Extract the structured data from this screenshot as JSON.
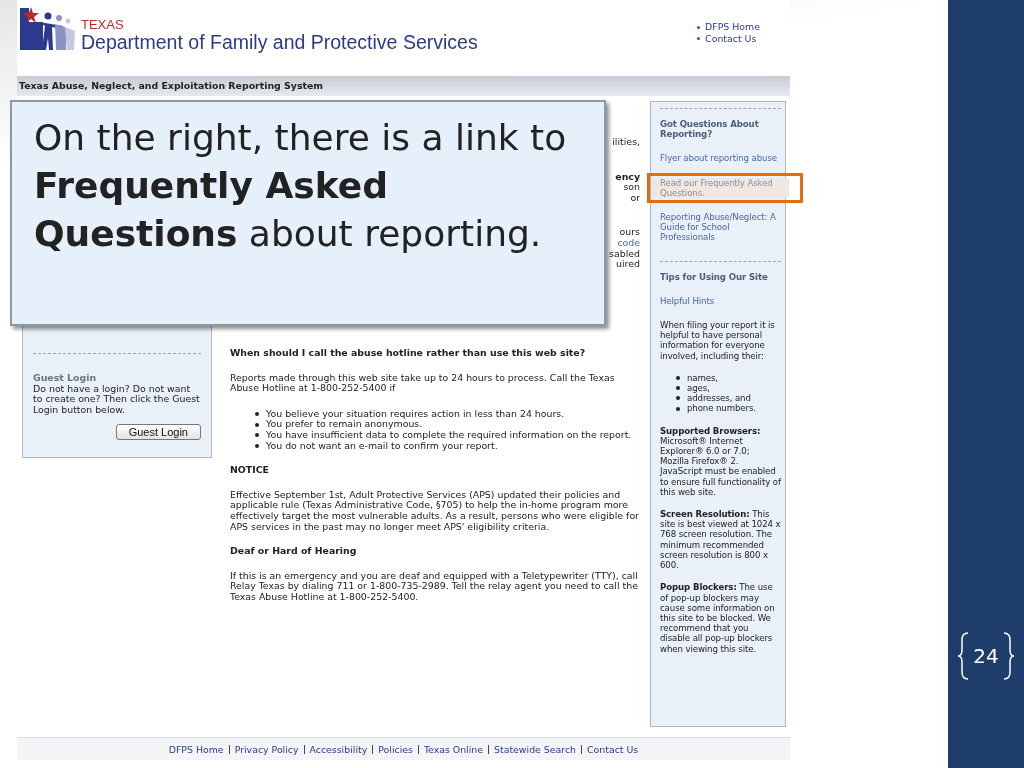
{
  "header": {
    "logo_small": "TEXAS",
    "logo_title": "Department of Family and Protective Services",
    "links": [
      "DFPS Home",
      "Contact Us"
    ]
  },
  "title_bar": "Texas Abuse, Neglect, and Exploitation Reporting System",
  "callout": "On the right, there is a link to **Frequently Asked Questions** about reporting.",
  "left_panel": {
    "heading": "Guest Login",
    "text": "Do not have a login? Do not want to create one? Then click the Guest Login button below.",
    "button": "Guest Login"
  },
  "covered_fragments": [
    [
      {
        "text": "ilities,",
        "kind": "plain"
      }
    ],
    [
      {
        "text": "ency",
        "kind": "bold"
      },
      {
        "text": "son",
        "kind": "plain"
      },
      {
        "text": "or",
        "kind": "plain"
      }
    ],
    [
      {
        "text": "ours",
        "kind": "plain"
      },
      {
        "text": "code",
        "kind": "link"
      },
      {
        "text": "sabled",
        "kind": "plain"
      },
      {
        "text": "uired",
        "kind": "plain"
      }
    ]
  ],
  "main": [
    {
      "kind": "heading",
      "text": "When should I call the abuse hotline rather than use this web site?"
    },
    {
      "kind": "paragraph",
      "text": "Reports made through this web site take up to 24 hours to process. Call the Texas Abuse Hotline at 1-800-252-5400 if"
    },
    {
      "kind": "list",
      "items": [
        "You believe your situation requires action in less than 24 hours.",
        "You prefer to remain anonymous.",
        "You have insufficient data to complete the required information on the report.",
        "You do not want an e-mail to confirm your report."
      ]
    },
    {
      "kind": "heading",
      "text": "NOTICE"
    },
    {
      "kind": "paragraph",
      "text": "Effective September 1st, Adult Protective Services (APS) updated their policies and applicable rule (Texas Administrative Code, §705) to help the in-home program more effectively target the most vulnerable adults. As a result, persons who were eligible for APS services in the past may no longer meet APS' eligibility criteria."
    },
    {
      "kind": "heading",
      "text": "Deaf or Hard of Hearing"
    },
    {
      "kind": "paragraph",
      "text": "If this is an emergency and you are deaf and equipped with a Teletypewriter (TTY), call Relay Texas by dialing 711 or 1-800-735-2989. Tell the relay agent you need to call the Texas Abuse Hotline at 1-800-252-5400."
    }
  ],
  "right_panel": [
    {
      "kind": "rule"
    },
    {
      "kind": "heading",
      "text": "Got Questions About Reporting?"
    },
    {
      "kind": "link",
      "text": "Flyer about reporting abuse",
      "highlighted": false
    },
    {
      "kind": "link",
      "text": "Read our Frequently Asked Questions.",
      "highlighted": true
    },
    {
      "kind": "link",
      "text": "Reporting Abuse/Neglect: A Guide for School Professionals",
      "highlighted": false
    },
    {
      "kind": "rule"
    },
    {
      "kind": "heading",
      "text": "Tips for Using Our Site"
    },
    {
      "kind": "link",
      "text": "Helpful Hints",
      "highlighted": false
    },
    {
      "kind": "paragraph",
      "text": "When filing your report it is helpful to have personal information for everyone involved, including their:"
    },
    {
      "kind": "list",
      "items": [
        "names,",
        "ages,",
        "addresses, and",
        "phone numbers."
      ]
    },
    {
      "kind": "paragraph",
      "text": "**Supported Browsers:** Microsoft® Internet Explorer® 6.0 or 7.0; Mozilla Firefox® 2. JavaScript must be enabled to ensure full functionality of this web site."
    },
    {
      "kind": "paragraph",
      "text": "**Screen Resolution:** This site is best viewed at 1024 x 768 screen resolution. The minimum recommended screen resolution is 800 x 600."
    },
    {
      "kind": "paragraph",
      "text": "**Popup Blockers:** The use of pop-up blockers may cause some information on this site to be blocked. We recommend that you disable all pop-up blockers when viewing this site."
    }
  ],
  "footer_links": [
    "DFPS Home",
    "Privacy Policy",
    "Accessibility",
    "Policies",
    "Texas Online",
    "Statewide Search",
    "Contact Us"
  ],
  "slide_number": "24"
}
